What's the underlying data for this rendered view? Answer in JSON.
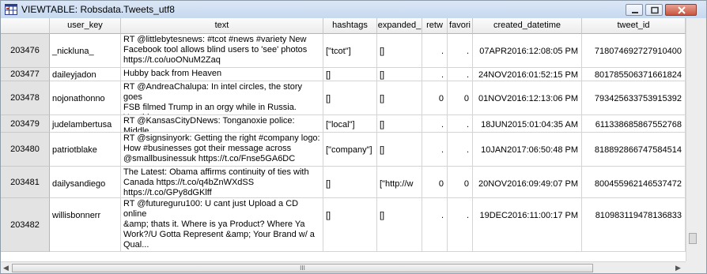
{
  "window": {
    "title": "VIEWTABLE: Robsdata.Tweets_utf8",
    "icon": "viewtable-grid-icon",
    "controls": [
      "minimize-icon",
      "maximize-icon",
      "close-icon"
    ]
  },
  "columns": [
    "user_key",
    "text",
    "hashtags",
    "expanded_",
    "retw",
    "favori",
    "created_datetime",
    "tweet_id"
  ],
  "rows": [
    {
      "num": "203476",
      "user_key": "_nickluna_",
      "text": "RT @littlebytesnews: #tcot #news #variety New\nFacebook tool allows blind users to 'see' photos\nhttps://t.co/uoONuM2Zaq",
      "hashtags": "[\"tcot\"]",
      "expanded": "[]",
      "retw": ".",
      "favori": ".",
      "created": "07APR2016:12:08:05 PM",
      "tweet_id": "718074692727910400"
    },
    {
      "num": "203477",
      "user_key": "daileyjadon",
      "text": "Hubby back from Heaven",
      "hashtags": "[]",
      "expanded": "[]",
      "retw": ".",
      "favori": ".",
      "created": "24NOV2016:01:52:15 PM",
      "tweet_id": "801785506371661824"
    },
    {
      "num": "203478",
      "user_key": "nojonathonno",
      "text": "RT @AndreaChalupa: In intel circles, the story goes\nFSB filmed Trump in an orgy while in Russia. Yes,this\nall ends in a Trump sex tape. htt...",
      "hashtags": "[]",
      "expanded": "[]",
      "retw": "0",
      "favori": "0",
      "created": "01NOV2016:12:13:06 PM",
      "tweet_id": "793425633753915392"
    },
    {
      "num": "203479",
      "user_key": "judelambertusa",
      "text": "RT @KansasCityDNews: Tonganoxie police: Middle\nschool girl sexually assaulted at party  #local",
      "hashtags": "[\"local\"]",
      "expanded": "[]",
      "retw": ".",
      "favori": ".",
      "created": "18JUN2015:01:04:35 AM",
      "tweet_id": "611338685867552768"
    },
    {
      "num": "203480",
      "user_key": "patriotblake",
      "text": "RT @signsinyork: Getting the right #company logo:\nHow #businesses got their message across\n@smallbusinessuk https://t.co/Fnse5GA6DC",
      "hashtags": "[\"company\"]",
      "expanded": "[]",
      "retw": ".",
      "favori": ".",
      "created": "10JAN2017:06:50:48 PM",
      "tweet_id": "818892866747584514"
    },
    {
      "num": "203481",
      "user_key": "dailysandiego",
      "text": "The Latest: Obama affirms continuity of ties with\nCanada https://t.co/q4bZnWXdSS\nhttps://t.co/GPy8dGKlff",
      "hashtags": "[]",
      "expanded": "[\"http://w",
      "retw": "0",
      "favori": "0",
      "created": "20NOV2016:09:49:07 PM",
      "tweet_id": "800455962146537472"
    },
    {
      "num": "203482",
      "user_key": "willisbonnerr",
      "text": "RT @futureguru100: U cant just Upload a CD online\n&amp; thats it. Where is ya Product? Where Ya\nWork?/U Gotta Represent &amp; Your Brand w/ a\nQual...",
      "hashtags": "[]",
      "expanded": "[]",
      "retw": ".",
      "favori": ".",
      "created": "19DEC2016:11:00:17 PM",
      "tweet_id": "810983119478136833"
    }
  ],
  "scrollbar": {
    "h_grip": "III"
  }
}
